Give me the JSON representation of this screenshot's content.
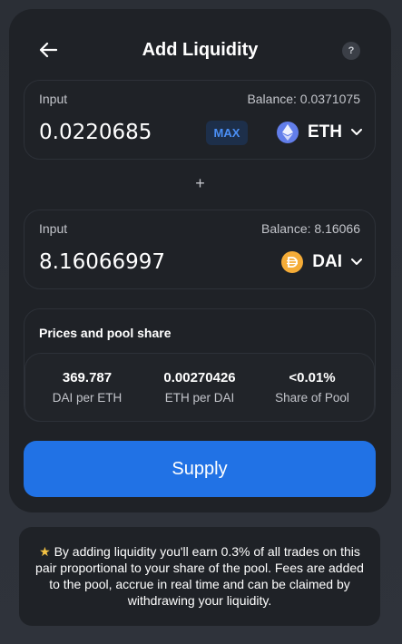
{
  "header": {
    "title": "Add Liquidity",
    "help_glyph": "?"
  },
  "token_a": {
    "label": "Input",
    "balance": "Balance: 0.0371075",
    "amount": "0.0220685",
    "max_label": "MAX",
    "symbol": "ETH",
    "icon": "ethereum-icon",
    "icon_color": "#627eea"
  },
  "separator": "+",
  "token_b": {
    "label": "Input",
    "balance": "Balance: 8.16066",
    "amount": "8.16066997",
    "symbol": "DAI",
    "icon": "dai-icon",
    "icon_color": "#f5ac37"
  },
  "prices": {
    "title": "Prices and pool share",
    "items": [
      {
        "value": "369.787",
        "label": "DAI per ETH"
      },
      {
        "value": "0.00270426",
        "label": "ETH per DAI"
      },
      {
        "value": "<0.01%",
        "label": "Share of Pool"
      }
    ]
  },
  "supply_label": "Supply",
  "info": {
    "star": "★",
    "text": "By adding liquidity you'll earn 0.3% of all trades on this pair proportional to your share of the pool. Fees are added to the pool, accrue in real time and can be claimed by withdrawing your liquidity."
  },
  "colors": {
    "accent": "#2172e5",
    "background": "#2b2f36",
    "card": "#1f2227"
  }
}
